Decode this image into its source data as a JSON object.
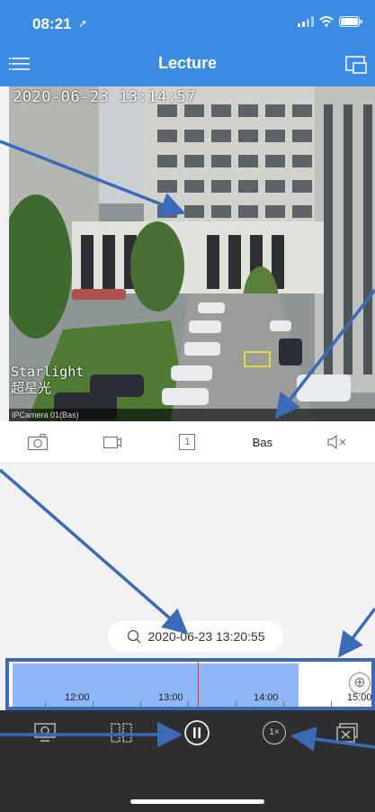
{
  "status": {
    "time": "08:21"
  },
  "header": {
    "title": "Lecture"
  },
  "video": {
    "osd_timestamp": "2020-06-23 13:14:57",
    "osd_line1": "Starlight",
    "osd_line2": "超星光",
    "camera_label": "IPCamera 01(Bas)"
  },
  "toolbar": {
    "stream_label": "Bas",
    "channel_label": "1"
  },
  "search": {
    "datetime": "2020-06-23 13:20:55"
  },
  "timeline": {
    "labels": [
      "12:00",
      "13:00",
      "14:00",
      "15:00"
    ]
  },
  "colors": {
    "primary": "#3a8ce3",
    "timeline_fill": "#8fb6f6",
    "cursor": "#e33333",
    "annotation": "#3a6ab8",
    "bottom_bar": "#2e2e30"
  },
  "icons": [
    "menu-icon",
    "window-icon",
    "camera-icon",
    "record-icon",
    "mute-icon",
    "search-icon",
    "zoom-in-icon",
    "screenshot-icon",
    "split-icon",
    "pause-icon",
    "speed-icon",
    "close-window-icon"
  ],
  "bottom": {
    "speed_label": "1×"
  }
}
